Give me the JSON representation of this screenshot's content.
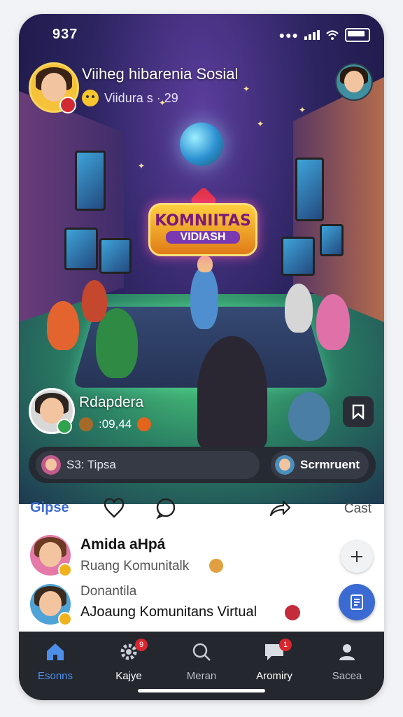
{
  "status": {
    "time": "937"
  },
  "header": {
    "title": "Viiheg hibarenia Sosial",
    "subtitle": "Viidura s · 29"
  },
  "banner": {
    "line1": "KOMNIITAS",
    "line2": "VIDIASH"
  },
  "poster": {
    "name": "Rdapdera",
    "meta": ":09,44"
  },
  "comment_bar": {
    "input_text": "S3: Tipsa",
    "button_label": "Scrmruent"
  },
  "actions": {
    "left_label": "Gipse",
    "right_label": "Cast"
  },
  "list": [
    {
      "title": "Amida aHpá",
      "subtitle": "Ruang Komunitalk"
    },
    {
      "subtitle": "Donantila",
      "title": "AJoaung Komunitans Virtual"
    }
  ],
  "nav": {
    "items": [
      {
        "label": "Esonns",
        "icon": "home-icon",
        "active": true
      },
      {
        "label": "Kajye",
        "icon": "gear-icon",
        "badge": "9"
      },
      {
        "label": "Meran",
        "icon": "search-icon"
      },
      {
        "label": "Aromiry",
        "icon": "chat-icon",
        "badge": "1"
      },
      {
        "label": "Sacea",
        "icon": "profile-icon"
      }
    ]
  },
  "colors": {
    "accent": "#3a6ad2",
    "nav_bg": "#24272e",
    "nav_active": "#4d8fe8",
    "badge": "#d8262f"
  }
}
